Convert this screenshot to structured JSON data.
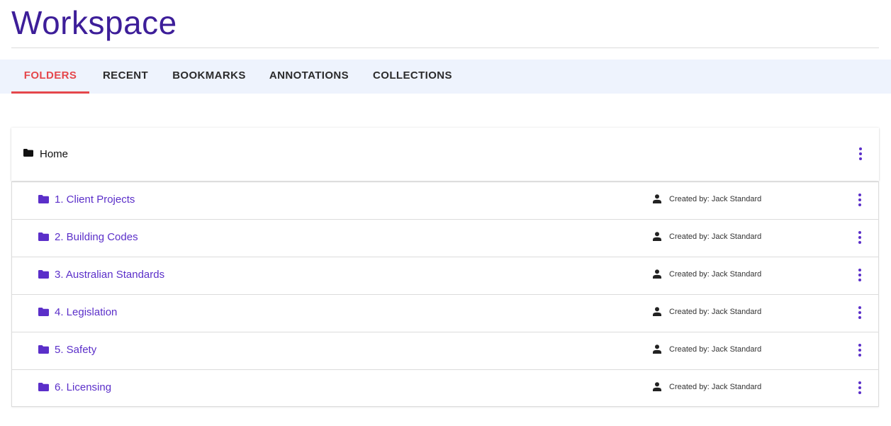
{
  "page": {
    "title": "Workspace"
  },
  "tabs": [
    {
      "label": "FOLDERS",
      "active": true
    },
    {
      "label": "RECENT",
      "active": false
    },
    {
      "label": "BOOKMARKS",
      "active": false
    },
    {
      "label": "ANNOTATIONS",
      "active": false
    },
    {
      "label": "COLLECTIONS",
      "active": false
    }
  ],
  "home": {
    "label": "Home",
    "icon": "folder-icon"
  },
  "folders": [
    {
      "name": "1. Client Projects",
      "creator": "Created by: Jack Standard"
    },
    {
      "name": "2. Building Codes",
      "creator": "Created by: Jack Standard"
    },
    {
      "name": "3. Australian Standards",
      "creator": "Created by: Jack Standard"
    },
    {
      "name": "4. Legislation",
      "creator": "Created by: Jack Standard"
    },
    {
      "name": "5. Safety",
      "creator": "Created by: Jack Standard"
    },
    {
      "name": "6. Licensing",
      "creator": "Created by: Jack Standard"
    }
  ],
  "icons": {
    "folder": "folder-icon",
    "creator": "person-icon",
    "more": "more-vertical-icon"
  },
  "colors": {
    "title": "#3d1e99",
    "tab_active": "#e5474b",
    "tab_bar_bg": "#eef3fd",
    "folder_link": "#5b2fc9"
  }
}
